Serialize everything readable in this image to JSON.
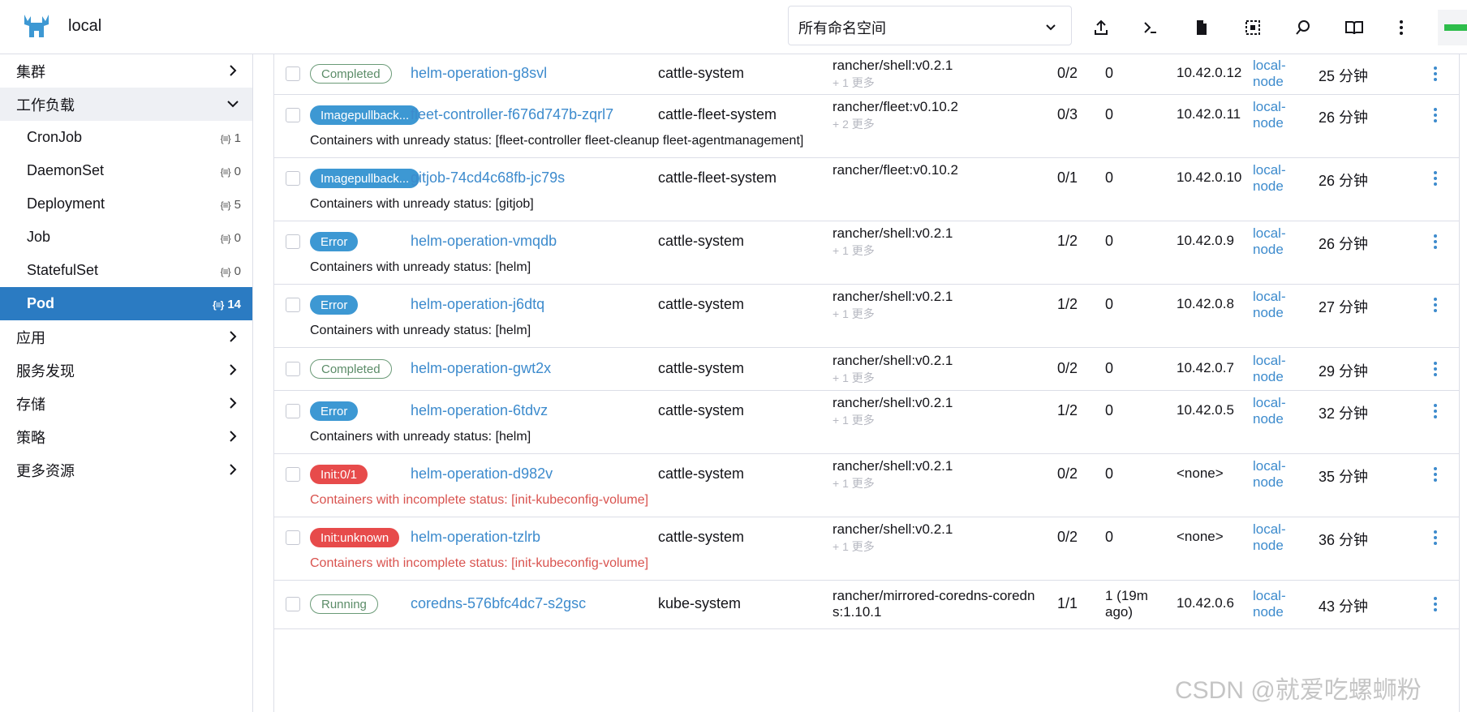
{
  "header": {
    "cluster_name": "local",
    "namespace_select": "所有命名空间",
    "icons": [
      "upload-icon",
      "terminal-icon",
      "file-icon",
      "copy-config-icon",
      "search-icon",
      "book-icon",
      "more-icon"
    ]
  },
  "sidebar": {
    "groups": [
      {
        "label": "集群",
        "open": false
      },
      {
        "label": "工作负载",
        "open": true
      },
      {
        "label": "应用",
        "open": false
      },
      {
        "label": "服务发现",
        "open": false
      },
      {
        "label": "存储",
        "open": false
      },
      {
        "label": "策略",
        "open": false
      },
      {
        "label": "更多资源",
        "open": false
      }
    ],
    "workload_items": [
      {
        "label": "CronJob",
        "count": "1"
      },
      {
        "label": "DaemonSet",
        "count": "0"
      },
      {
        "label": "Deployment",
        "count": "5"
      },
      {
        "label": "Job",
        "count": "0"
      },
      {
        "label": "StatefulSet",
        "count": "0"
      },
      {
        "label": "Pod",
        "count": "14"
      }
    ]
  },
  "pods": [
    {
      "state": "Completed",
      "style": "completed",
      "name": "helm-operation-g8svl",
      "namespace": "cattle-system",
      "image": "rancher/shell:v0.2.1",
      "image_more": "+ 1 更多",
      "ready": "0/2",
      "restarts": "0",
      "ip": "10.42.0.12",
      "node1": "local-",
      "node2": "node",
      "age": "25 分钟",
      "detail": ""
    },
    {
      "state": "Imagepullback...",
      "style": "info",
      "name": "fleet-controller-f676d747b-zqrl7",
      "namespace": "cattle-fleet-system",
      "image": "rancher/fleet:v0.10.2",
      "image_more": "+ 2 更多",
      "ready": "0/3",
      "restarts": "0",
      "ip": "10.42.0.11",
      "node1": "local-",
      "node2": "node",
      "age": "26 分钟",
      "detail": "Containers with unready status: [fleet-controller fleet-cleanup fleet-agentmanagement]"
    },
    {
      "state": "Imagepullback...",
      "style": "info",
      "name": "gitjob-74cd4c68fb-jc79s",
      "namespace": "cattle-fleet-system",
      "image": "rancher/fleet:v0.10.2",
      "image_more": "",
      "ready": "0/1",
      "restarts": "0",
      "ip": "10.42.0.10",
      "node1": "local-",
      "node2": "node",
      "age": "26 分钟",
      "detail": "Containers with unready status: [gitjob]"
    },
    {
      "state": "Error",
      "style": "error-blue",
      "name": "helm-operation-vmqdb",
      "namespace": "cattle-system",
      "image": "rancher/shell:v0.2.1",
      "image_more": "+ 1 更多",
      "ready": "1/2",
      "restarts": "0",
      "ip": "10.42.0.9",
      "node1": "local-",
      "node2": "node",
      "age": "26 分钟",
      "detail": "Containers with unready status: [helm]"
    },
    {
      "state": "Error",
      "style": "error-blue",
      "name": "helm-operation-j6dtq",
      "namespace": "cattle-system",
      "image": "rancher/shell:v0.2.1",
      "image_more": "+ 1 更多",
      "ready": "1/2",
      "restarts": "0",
      "ip": "10.42.0.8",
      "node1": "local-",
      "node2": "node",
      "age": "27 分钟",
      "detail": "Containers with unready status: [helm]"
    },
    {
      "state": "Completed",
      "style": "completed",
      "name": "helm-operation-gwt2x",
      "namespace": "cattle-system",
      "image": "rancher/shell:v0.2.1",
      "image_more": "+ 1 更多",
      "ready": "0/2",
      "restarts": "0",
      "ip": "10.42.0.7",
      "node1": "local-",
      "node2": "node",
      "age": "29 分钟",
      "detail": ""
    },
    {
      "state": "Error",
      "style": "error-blue",
      "name": "helm-operation-6tdvz",
      "namespace": "cattle-system",
      "image": "rancher/shell:v0.2.1",
      "image_more": "+ 1 更多",
      "ready": "1/2",
      "restarts": "0",
      "ip": "10.42.0.5",
      "node1": "local-",
      "node2": "node",
      "age": "32 分钟",
      "detail": "Containers with unready status: [helm]"
    },
    {
      "state": "Init:0/1",
      "style": "red",
      "name": "helm-operation-d982v",
      "namespace": "cattle-system",
      "image": "rancher/shell:v0.2.1",
      "image_more": "+ 1 更多",
      "ready": "0/2",
      "restarts": "0",
      "ip": "<none>",
      "node1": "local-",
      "node2": "node",
      "age": "35 分钟",
      "detail": "Containers with incomplete status: [init-kubeconfig-volume]",
      "detail_red": true
    },
    {
      "state": "Init:unknown",
      "style": "red",
      "name": "helm-operation-tzlrb",
      "namespace": "cattle-system",
      "image": "rancher/shell:v0.2.1",
      "image_more": "+ 1 更多",
      "ready": "0/2",
      "restarts": "0",
      "ip": "<none>",
      "node1": "local-",
      "node2": "node",
      "age": "36 分钟",
      "detail": "Containers with incomplete status: [init-kubeconfig-volume]",
      "detail_red": true
    },
    {
      "state": "Running",
      "style": "running",
      "name": "coredns-576bfc4dc7-s2gsc",
      "namespace": "kube-system",
      "image": "rancher/mirrored-coredns-coredn",
      "image2": "s:1.10.1",
      "image_more": "",
      "ready": "1/1",
      "restarts": "1 (19m",
      "restarts2": "ago)",
      "ip": "10.42.0.6",
      "node1": "local-",
      "node2": "node",
      "age": "43 分钟",
      "detail": ""
    }
  ],
  "watermark": "CSDN @就爱吃螺蛳粉"
}
